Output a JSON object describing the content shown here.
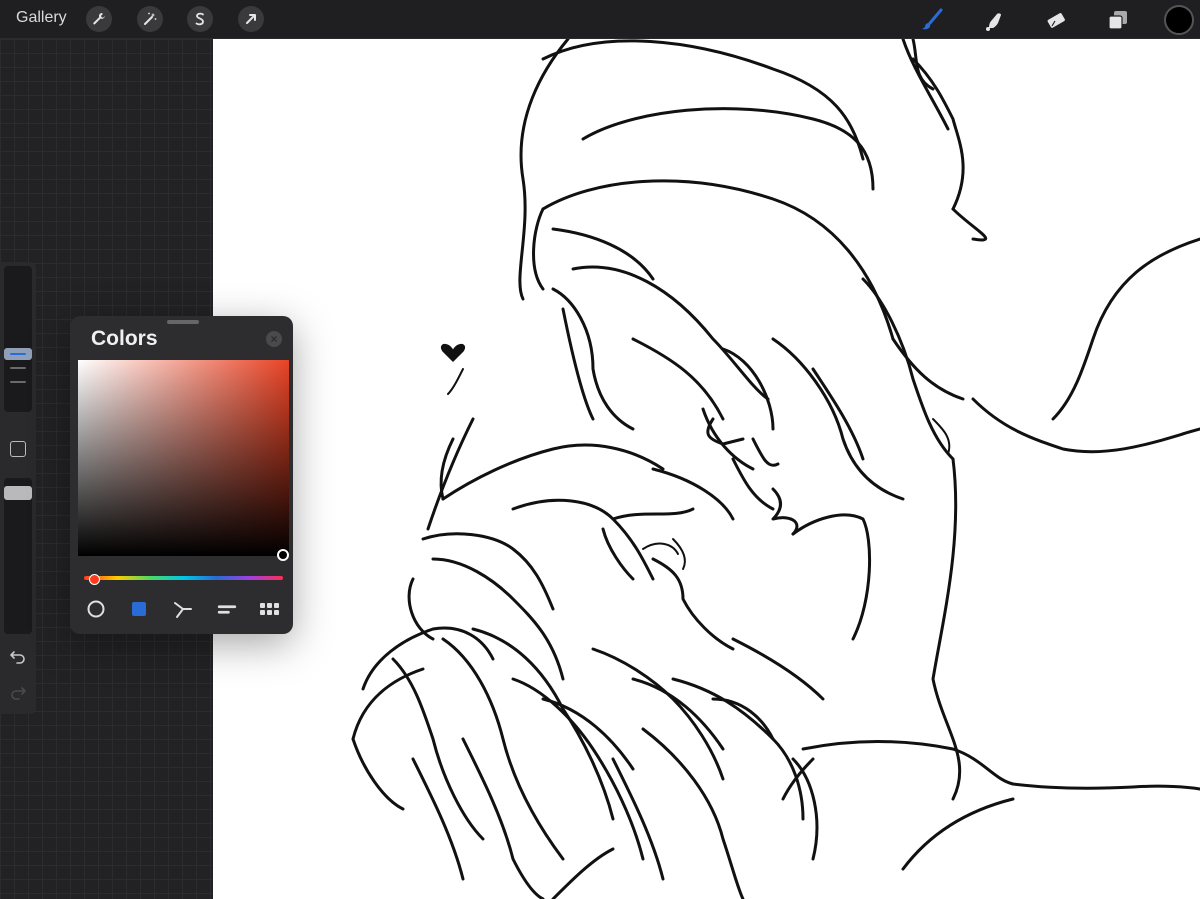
{
  "toolbar": {
    "gallery_label": "Gallery",
    "actions_icons": [
      "wrench-icon",
      "magic-wand-icon",
      "selection-icon",
      "transform-arrow-icon"
    ],
    "tools_icons": [
      "brush-icon",
      "smudge-icon",
      "eraser-icon",
      "layers-icon"
    ],
    "active_tool": "brush",
    "current_color": "#000000",
    "accent_color": "#2b6bd6"
  },
  "sidebar": {
    "controls": [
      "brush-size-slider",
      "modify-button",
      "opacity-slider",
      "undo-button",
      "redo-button"
    ]
  },
  "colors_panel": {
    "title": "Colors",
    "selected_color": "#000000",
    "hue_color": "#e94325",
    "modes": [
      "disc",
      "classic",
      "harmony",
      "value",
      "palettes"
    ],
    "active_mode": "classic"
  }
}
